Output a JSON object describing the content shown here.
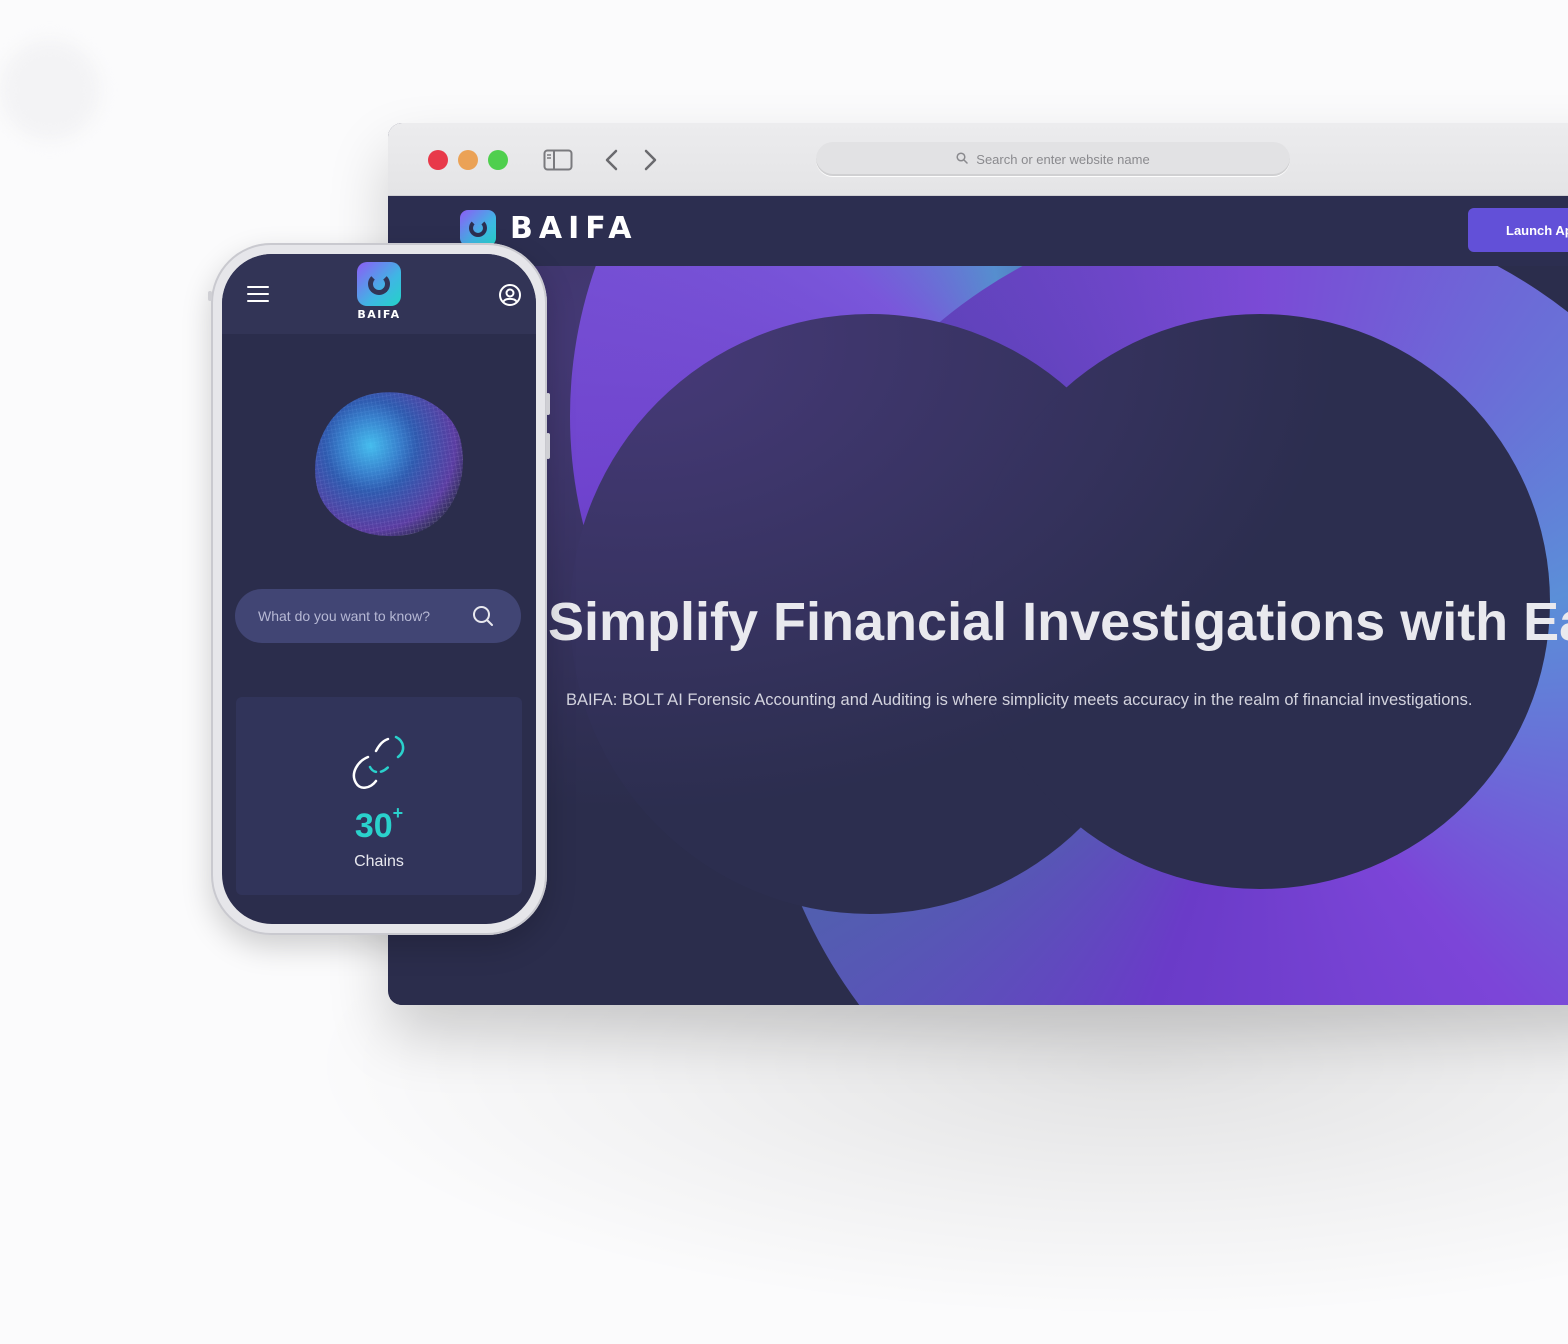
{
  "browser": {
    "address_placeholder": "Search or enter website name",
    "traffic_lights": {
      "close": "#e8394a",
      "minimize": "#eba256",
      "maximize": "#4fcf4e"
    },
    "icons": [
      "sidebar-icon",
      "back-chevron-icon",
      "forward-chevron-icon",
      "search-icon"
    ]
  },
  "site": {
    "logo_text": "BAIFA",
    "launch_button": "Launch App",
    "hero_title": "Simplify Financial Investigations with Ease",
    "hero_subtitle": "BAIFA: BOLT AI Forensic Accounting and Auditing is where simplicity meets accuracy in the realm of financial investigations.",
    "colors": {
      "accent": "#6250d8",
      "background": "#2b2d4e"
    }
  },
  "mobile": {
    "logo_text": "BAIFA",
    "search_placeholder": "What do you want to know?",
    "stat": {
      "value": "30",
      "suffix": "+",
      "label": "Chains"
    },
    "icons": [
      "hamburger-menu-icon",
      "user-account-icon",
      "search-icon",
      "chain-link-icon"
    ],
    "colors": {
      "stat_value": "#2ad1cc",
      "search_bg": "#414574"
    }
  }
}
